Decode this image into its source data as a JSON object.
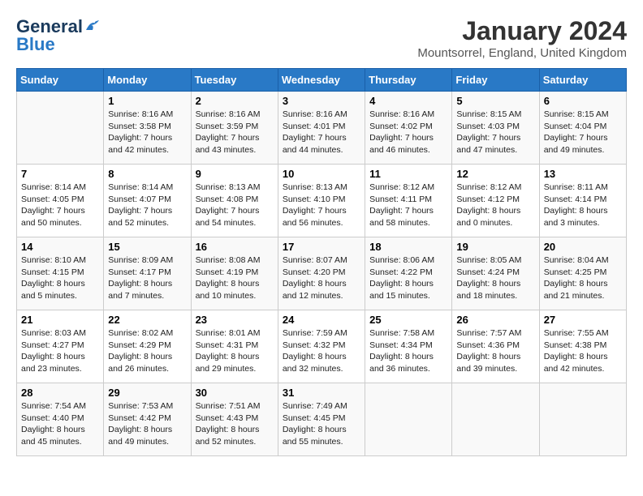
{
  "logo": {
    "line1": "General",
    "line2": "Blue"
  },
  "title": "January 2024",
  "subtitle": "Mountsorrel, England, United Kingdom",
  "weekdays": [
    "Sunday",
    "Monday",
    "Tuesday",
    "Wednesday",
    "Thursday",
    "Friday",
    "Saturday"
  ],
  "weeks": [
    [
      {
        "day": "",
        "info": ""
      },
      {
        "day": "1",
        "info": "Sunrise: 8:16 AM\nSunset: 3:58 PM\nDaylight: 7 hours\nand 42 minutes."
      },
      {
        "day": "2",
        "info": "Sunrise: 8:16 AM\nSunset: 3:59 PM\nDaylight: 7 hours\nand 43 minutes."
      },
      {
        "day": "3",
        "info": "Sunrise: 8:16 AM\nSunset: 4:01 PM\nDaylight: 7 hours\nand 44 minutes."
      },
      {
        "day": "4",
        "info": "Sunrise: 8:16 AM\nSunset: 4:02 PM\nDaylight: 7 hours\nand 46 minutes."
      },
      {
        "day": "5",
        "info": "Sunrise: 8:15 AM\nSunset: 4:03 PM\nDaylight: 7 hours\nand 47 minutes."
      },
      {
        "day": "6",
        "info": "Sunrise: 8:15 AM\nSunset: 4:04 PM\nDaylight: 7 hours\nand 49 minutes."
      }
    ],
    [
      {
        "day": "7",
        "info": "Sunrise: 8:14 AM\nSunset: 4:05 PM\nDaylight: 7 hours\nand 50 minutes."
      },
      {
        "day": "8",
        "info": "Sunrise: 8:14 AM\nSunset: 4:07 PM\nDaylight: 7 hours\nand 52 minutes."
      },
      {
        "day": "9",
        "info": "Sunrise: 8:13 AM\nSunset: 4:08 PM\nDaylight: 7 hours\nand 54 minutes."
      },
      {
        "day": "10",
        "info": "Sunrise: 8:13 AM\nSunset: 4:10 PM\nDaylight: 7 hours\nand 56 minutes."
      },
      {
        "day": "11",
        "info": "Sunrise: 8:12 AM\nSunset: 4:11 PM\nDaylight: 7 hours\nand 58 minutes."
      },
      {
        "day": "12",
        "info": "Sunrise: 8:12 AM\nSunset: 4:12 PM\nDaylight: 8 hours\nand 0 minutes."
      },
      {
        "day": "13",
        "info": "Sunrise: 8:11 AM\nSunset: 4:14 PM\nDaylight: 8 hours\nand 3 minutes."
      }
    ],
    [
      {
        "day": "14",
        "info": "Sunrise: 8:10 AM\nSunset: 4:15 PM\nDaylight: 8 hours\nand 5 minutes."
      },
      {
        "day": "15",
        "info": "Sunrise: 8:09 AM\nSunset: 4:17 PM\nDaylight: 8 hours\nand 7 minutes."
      },
      {
        "day": "16",
        "info": "Sunrise: 8:08 AM\nSunset: 4:19 PM\nDaylight: 8 hours\nand 10 minutes."
      },
      {
        "day": "17",
        "info": "Sunrise: 8:07 AM\nSunset: 4:20 PM\nDaylight: 8 hours\nand 12 minutes."
      },
      {
        "day": "18",
        "info": "Sunrise: 8:06 AM\nSunset: 4:22 PM\nDaylight: 8 hours\nand 15 minutes."
      },
      {
        "day": "19",
        "info": "Sunrise: 8:05 AM\nSunset: 4:24 PM\nDaylight: 8 hours\nand 18 minutes."
      },
      {
        "day": "20",
        "info": "Sunrise: 8:04 AM\nSunset: 4:25 PM\nDaylight: 8 hours\nand 21 minutes."
      }
    ],
    [
      {
        "day": "21",
        "info": "Sunrise: 8:03 AM\nSunset: 4:27 PM\nDaylight: 8 hours\nand 23 minutes."
      },
      {
        "day": "22",
        "info": "Sunrise: 8:02 AM\nSunset: 4:29 PM\nDaylight: 8 hours\nand 26 minutes."
      },
      {
        "day": "23",
        "info": "Sunrise: 8:01 AM\nSunset: 4:31 PM\nDaylight: 8 hours\nand 29 minutes."
      },
      {
        "day": "24",
        "info": "Sunrise: 7:59 AM\nSunset: 4:32 PM\nDaylight: 8 hours\nand 32 minutes."
      },
      {
        "day": "25",
        "info": "Sunrise: 7:58 AM\nSunset: 4:34 PM\nDaylight: 8 hours\nand 36 minutes."
      },
      {
        "day": "26",
        "info": "Sunrise: 7:57 AM\nSunset: 4:36 PM\nDaylight: 8 hours\nand 39 minutes."
      },
      {
        "day": "27",
        "info": "Sunrise: 7:55 AM\nSunset: 4:38 PM\nDaylight: 8 hours\nand 42 minutes."
      }
    ],
    [
      {
        "day": "28",
        "info": "Sunrise: 7:54 AM\nSunset: 4:40 PM\nDaylight: 8 hours\nand 45 minutes."
      },
      {
        "day": "29",
        "info": "Sunrise: 7:53 AM\nSunset: 4:42 PM\nDaylight: 8 hours\nand 49 minutes."
      },
      {
        "day": "30",
        "info": "Sunrise: 7:51 AM\nSunset: 4:43 PM\nDaylight: 8 hours\nand 52 minutes."
      },
      {
        "day": "31",
        "info": "Sunrise: 7:49 AM\nSunset: 4:45 PM\nDaylight: 8 hours\nand 55 minutes."
      },
      {
        "day": "",
        "info": ""
      },
      {
        "day": "",
        "info": ""
      },
      {
        "day": "",
        "info": ""
      }
    ]
  ]
}
